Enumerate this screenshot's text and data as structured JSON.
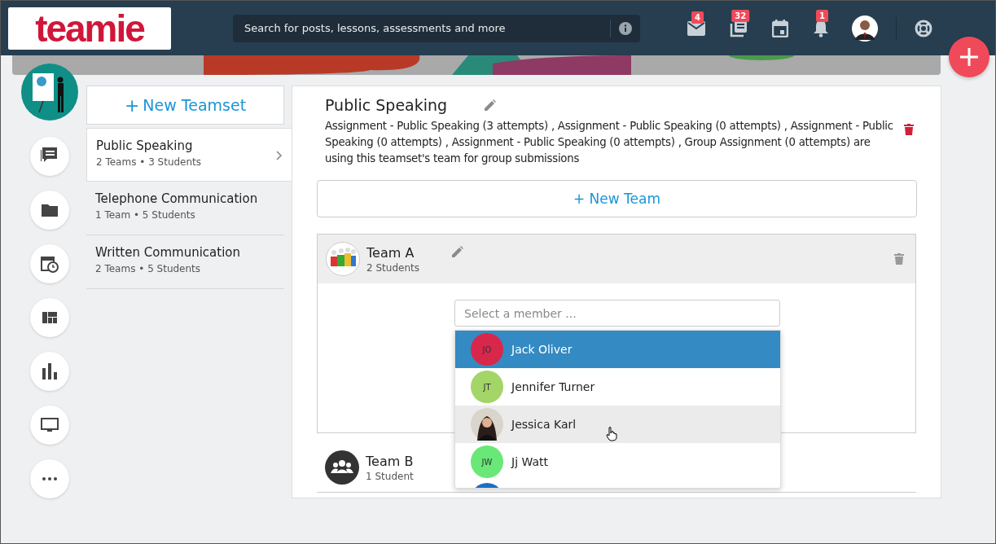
{
  "header": {
    "logo": "teamie",
    "search": {
      "placeholder": "Search for posts, lessons, assessments and more"
    },
    "notifications": [
      {
        "kind": "mail",
        "count": "4"
      },
      {
        "kind": "posts",
        "count": "32"
      },
      {
        "kind": "calendar"
      },
      {
        "kind": "bell",
        "count": "1"
      }
    ]
  },
  "rail": [
    {
      "kind": "chat"
    },
    {
      "kind": "folder"
    },
    {
      "kind": "schedule"
    },
    {
      "kind": "dashboard"
    },
    {
      "kind": "chart"
    },
    {
      "kind": "screen"
    },
    {
      "kind": "more"
    }
  ],
  "new_teamset": {
    "icon": "+",
    "label": "New Teamset"
  },
  "teamsets": [
    {
      "name": "Public Speaking",
      "meta": "2 Teams • 3 Students",
      "selected": true
    },
    {
      "name": "Telephone Communication",
      "meta": "1 Team • 5 Students",
      "selected": false
    },
    {
      "name": "Written Communication",
      "meta": "2 Teams • 5 Students",
      "selected": false
    }
  ],
  "detail": {
    "title": "Public Speaking",
    "description": "Assignment - Public Speaking (3 attempts) , Assignment - Public Speaking (0 attempts) , Assignment - Public Speaking (0 attempts) , Assignment - Public Speaking (0 attempts) , Group Assignment (0 attempts) are using this teamset's team for group submissions",
    "new_team": {
      "icon": "+",
      "label": "New Team"
    },
    "teams": [
      {
        "name": "Team A",
        "count": "2 Students",
        "kind": "picture",
        "expanded": true
      },
      {
        "name": "Team B",
        "count": "1 Student",
        "kind": "group",
        "expanded": false
      }
    ],
    "member_select": {
      "placeholder": "Select a member ...",
      "options": [
        {
          "kind": "initials",
          "initials": "JO",
          "name": "Jack Oliver",
          "color": "#d9274b",
          "selected": true,
          "hovered": false
        },
        {
          "kind": "initials",
          "initials": "JT",
          "name": "Jennifer Turner",
          "color": "#a3d568",
          "selected": false,
          "hovered": false
        },
        {
          "name": "Jessica Karl",
          "selected": false,
          "hovered": true
        },
        {
          "kind": "initials",
          "initials": "JW",
          "name": "Jj Watt",
          "color": "#6ae877",
          "selected": false,
          "hovered": false
        },
        {
          "kind": "initials",
          "color": "#1a6fc4",
          "selected": false,
          "hovered": false
        }
      ]
    }
  }
}
